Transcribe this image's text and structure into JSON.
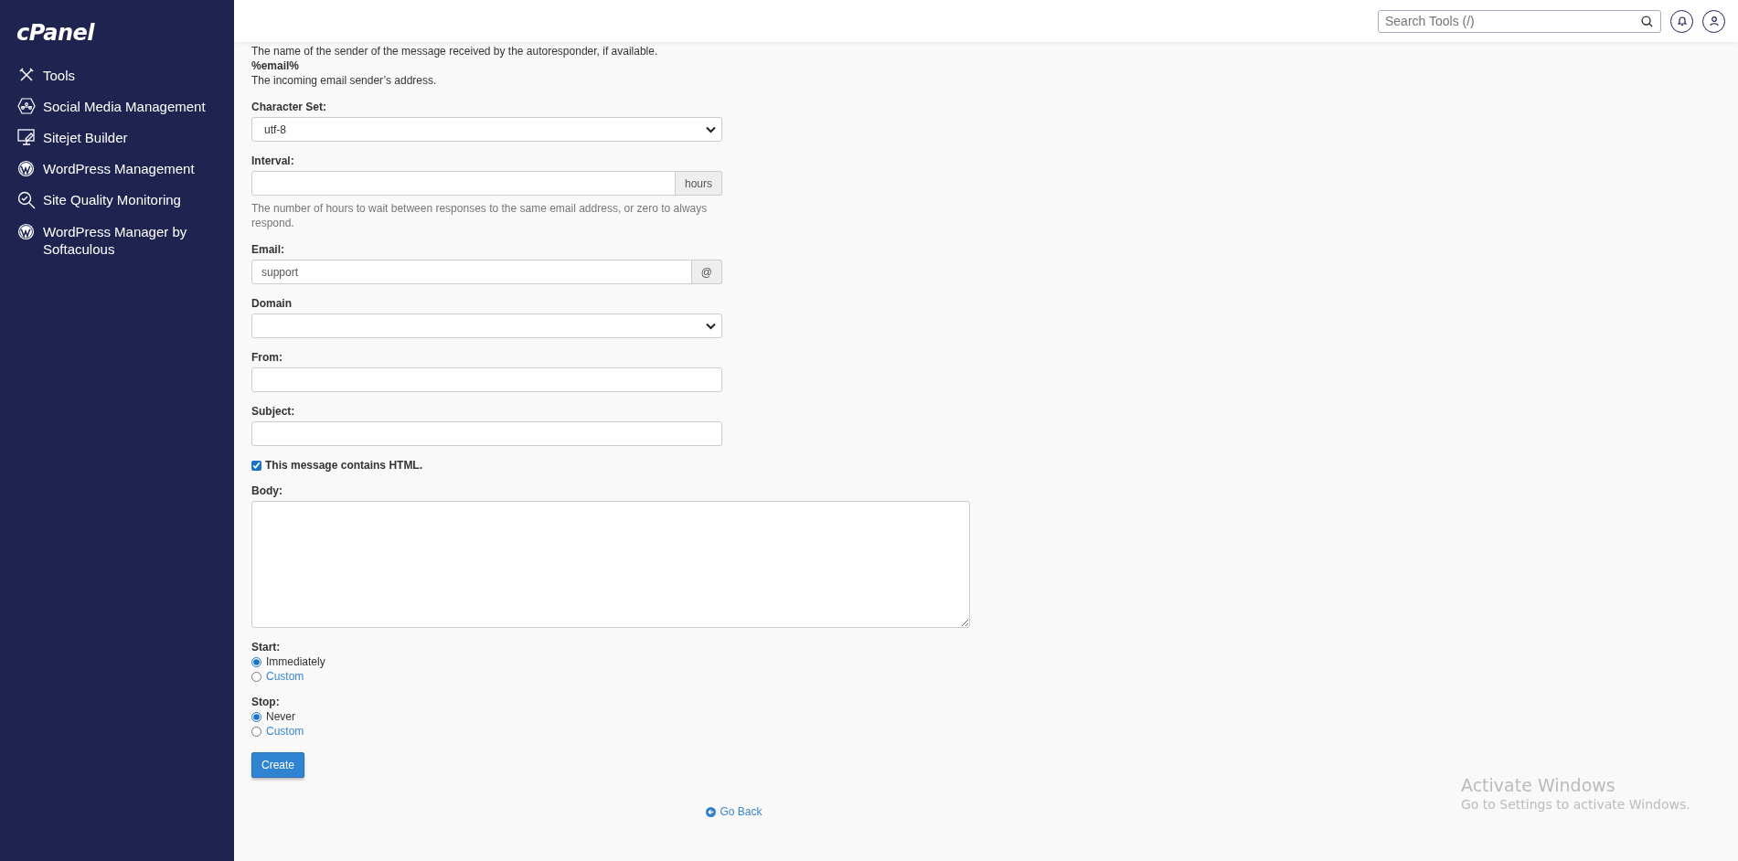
{
  "sidebar": {
    "logo": "cPanel",
    "items": [
      {
        "label": "Tools"
      },
      {
        "label": "Social Media Management"
      },
      {
        "label": "Sitejet Builder"
      },
      {
        "label": "WordPress Management"
      },
      {
        "label": "Site Quality Monitoring"
      },
      {
        "label": "WordPress Manager by Softaculous"
      }
    ]
  },
  "topbar": {
    "search": {
      "placeholder": "Search Tools (/)"
    }
  },
  "intro": [
    {
      "text": "The name of the sender of the message received by the autoresponder, if available.",
      "bold": false
    },
    {
      "text": "%email%",
      "bold": true
    },
    {
      "text": "The incoming email sender’s address.",
      "bold": false
    }
  ],
  "form": [
    {
      "kind": "select",
      "label": "Character Set:",
      "value": "utf-8"
    },
    {
      "kind": "addon",
      "label": "Interval:",
      "addon": "hours",
      "help": "The number of hours to wait between responses to the same email address, or zero to always respond."
    },
    {
      "kind": "addon",
      "label": "Email:",
      "value": "support",
      "addon": "@"
    },
    {
      "kind": "select",
      "label": "Domain"
    },
    {
      "kind": "text",
      "label": "From:"
    },
    {
      "kind": "text",
      "label": "Subject:"
    },
    {
      "kind": "checkbox",
      "label": "This message contains HTML.",
      "checked": true
    },
    {
      "kind": "textarea",
      "label": "Body:"
    },
    {
      "kind": "radio",
      "label": "Start:",
      "options": [
        {
          "label": "Immediately",
          "selected": true
        },
        {
          "label": "Custom",
          "selected": false
        }
      ]
    },
    {
      "kind": "radio",
      "label": "Stop:",
      "options": [
        {
          "label": "Never",
          "selected": true
        },
        {
          "label": "Custom",
          "selected": false
        }
      ]
    }
  ],
  "create_button": "Create",
  "go_back": "Go Back",
  "os_notice": {
    "title": "Activate Windows",
    "text": "Go to Settings to activate Windows."
  }
}
